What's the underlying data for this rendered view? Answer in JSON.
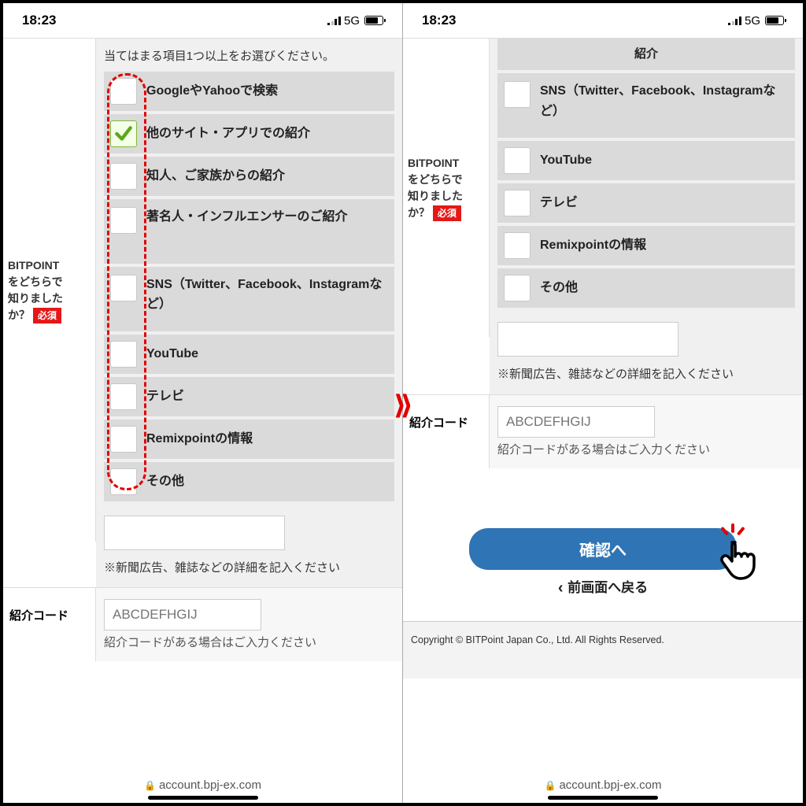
{
  "status": {
    "time": "18:23",
    "network": "5G"
  },
  "arrow_icon_name": "double-chevron-right-icon",
  "left": {
    "question": {
      "label_l1": "BITPOINT",
      "label_l2": "をどちらで",
      "label_l3": "知りました",
      "label_l4": "か？",
      "required": "必須"
    },
    "instruction": "当てはまる項目1つ以上をお選びください。",
    "options": [
      {
        "label": "GoogleやYahooで検索",
        "checked": false
      },
      {
        "label": "他のサイト・アプリでの紹介",
        "checked": true
      },
      {
        "label": "知人、ご家族からの紹介",
        "checked": false
      },
      {
        "label": "著名人・インフルエンサーのご紹介",
        "checked": false
      },
      {
        "label": "SNS（Twitter、Facebook、Instagramなど）",
        "checked": false
      },
      {
        "label": "YouTube",
        "checked": false
      },
      {
        "label": "テレビ",
        "checked": false
      },
      {
        "label": "Remixpointの情報",
        "checked": false
      },
      {
        "label": "その他",
        "checked": false
      }
    ],
    "detail_note": "※新聞広告、雑誌などの詳細を記入ください",
    "ref": {
      "label": "紹介コード",
      "placeholder": "ABCDEFHGIJ",
      "help": "紹介コードがある場合はご入力ください"
    },
    "url": "account.bpj-ex.com"
  },
  "right": {
    "question": {
      "label_l1": "BITPOINT",
      "label_l2": "をどちらで",
      "label_l3": "知りました",
      "label_l4": "か？",
      "required": "必須"
    },
    "top_partial": "紹介",
    "options": [
      {
        "label": "SNS（Twitter、Facebook、Instagramなど）"
      },
      {
        "label": "YouTube"
      },
      {
        "label": "テレビ"
      },
      {
        "label": "Remixpointの情報"
      },
      {
        "label": "その他"
      }
    ],
    "detail_note": "※新聞広告、雑誌などの詳細を記入ください",
    "ref": {
      "label": "紹介コード",
      "placeholder": "ABCDEFHGIJ",
      "help": "紹介コードがある場合はご入力ください"
    },
    "confirm_btn": "確認へ",
    "back_link": "前画面へ戻る",
    "copyright": "Copyright © BITPoint Japan Co., Ltd. All Rights Reserved.",
    "url": "account.bpj-ex.com"
  }
}
